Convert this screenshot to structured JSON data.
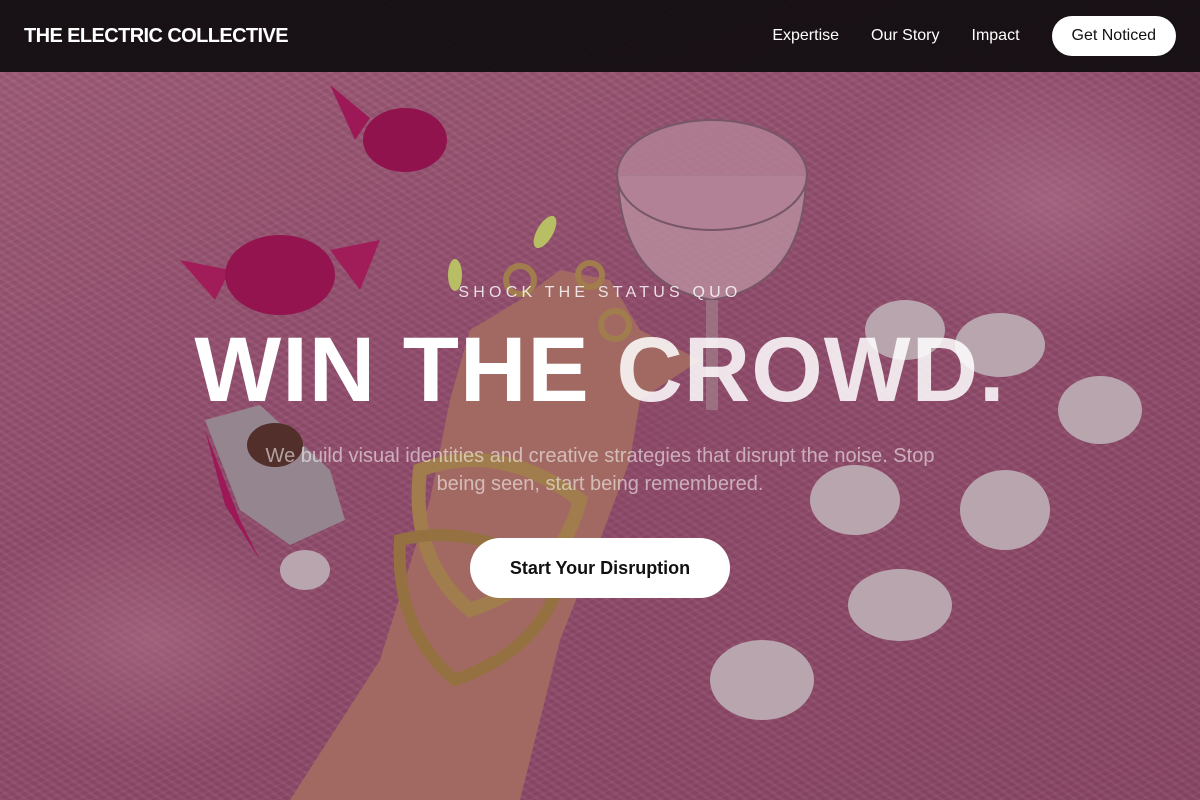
{
  "navbar": {
    "brand": "THE ELECTRIC COLLECTIVE",
    "links": [
      {
        "label": "Expertise"
      },
      {
        "label": "Our Story"
      },
      {
        "label": "Impact"
      }
    ],
    "cta_label": "Get Noticed"
  },
  "hero": {
    "eyebrow": "SHOCK THE STATUS QUO",
    "headline_part1": "WIN THE ",
    "headline_part2": "CROWD.",
    "subtext": "We build visual identities and creative strategies that disrupt the noise. Stop being seen, start being remembered.",
    "cta_label": "Start Your Disruption"
  },
  "colors": {
    "nav_background": "#140e12",
    "background_pink": "#b86a8c",
    "button_background": "#ffffff",
    "button_text": "#111111"
  }
}
